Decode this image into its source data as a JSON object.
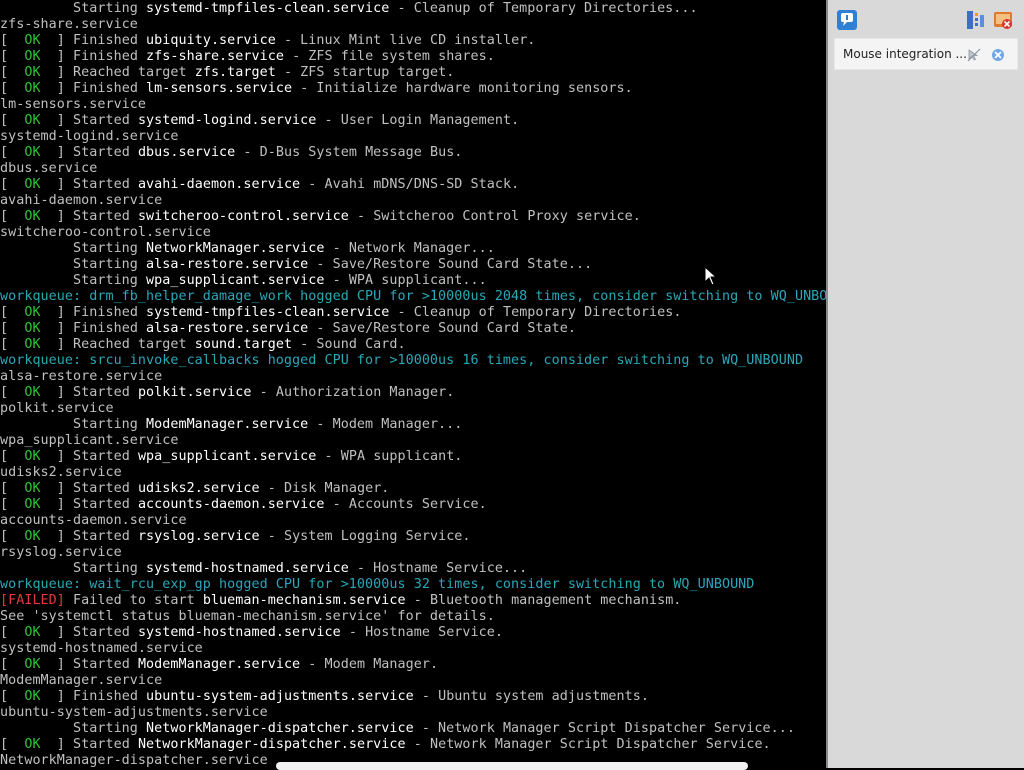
{
  "console": {
    "lines": [
      [
        [
          "plain",
          "         Starting "
        ],
        [
          "unit",
          "systemd-tmpfiles-clean.service"
        ],
        [
          "desc",
          " - Cleanup of Temporary Directories..."
        ]
      ],
      [
        [
          "plain",
          "zfs-share.service"
        ]
      ],
      [
        [
          "bracket",
          "[  "
        ],
        [
          "ok",
          "OK"
        ],
        [
          "bracket",
          "  ] "
        ],
        [
          "desc",
          "Finished "
        ],
        [
          "unit",
          "ubiquity.service"
        ],
        [
          "desc",
          " - Linux Mint live CD installer."
        ]
      ],
      [
        [
          "bracket",
          "[  "
        ],
        [
          "ok",
          "OK"
        ],
        [
          "bracket",
          "  ] "
        ],
        [
          "desc",
          "Finished "
        ],
        [
          "unit",
          "zfs-share.service"
        ],
        [
          "desc",
          " - ZFS file system shares."
        ]
      ],
      [
        [
          "bracket",
          "[  "
        ],
        [
          "ok",
          "OK"
        ],
        [
          "bracket",
          "  ] "
        ],
        [
          "desc",
          "Reached target "
        ],
        [
          "unit",
          "zfs.target"
        ],
        [
          "desc",
          " - ZFS startup target."
        ]
      ],
      [
        [
          "bracket",
          "[  "
        ],
        [
          "ok",
          "OK"
        ],
        [
          "bracket",
          "  ] "
        ],
        [
          "desc",
          "Finished "
        ],
        [
          "unit",
          "lm-sensors.service"
        ],
        [
          "desc",
          " - Initialize hardware monitoring sensors."
        ]
      ],
      [
        [
          "plain",
          "lm-sensors.service"
        ]
      ],
      [
        [
          "bracket",
          "[  "
        ],
        [
          "ok",
          "OK"
        ],
        [
          "bracket",
          "  ] "
        ],
        [
          "desc",
          "Started "
        ],
        [
          "unit",
          "systemd-logind.service"
        ],
        [
          "desc",
          " - User Login Management."
        ]
      ],
      [
        [
          "plain",
          "systemd-logind.service"
        ]
      ],
      [
        [
          "bracket",
          "[  "
        ],
        [
          "ok",
          "OK"
        ],
        [
          "bracket",
          "  ] "
        ],
        [
          "desc",
          "Started "
        ],
        [
          "unit",
          "dbus.service"
        ],
        [
          "desc",
          " - D-Bus System Message Bus."
        ]
      ],
      [
        [
          "plain",
          "dbus.service"
        ]
      ],
      [
        [
          "bracket",
          "[  "
        ],
        [
          "ok",
          "OK"
        ],
        [
          "bracket",
          "  ] "
        ],
        [
          "desc",
          "Started "
        ],
        [
          "unit",
          "avahi-daemon.service"
        ],
        [
          "desc",
          " - Avahi mDNS/DNS-SD Stack."
        ]
      ],
      [
        [
          "plain",
          "avahi-daemon.service"
        ]
      ],
      [
        [
          "bracket",
          "[  "
        ],
        [
          "ok",
          "OK"
        ],
        [
          "bracket",
          "  ] "
        ],
        [
          "desc",
          "Started "
        ],
        [
          "unit",
          "switcheroo-control.service"
        ],
        [
          "desc",
          " - Switcheroo Control Proxy service."
        ]
      ],
      [
        [
          "plain",
          "switcheroo-control.service"
        ]
      ],
      [
        [
          "plain",
          "         Starting "
        ],
        [
          "unit",
          "NetworkManager.service"
        ],
        [
          "desc",
          " - Network Manager..."
        ]
      ],
      [
        [
          "plain",
          "         Starting "
        ],
        [
          "unit",
          "alsa-restore.service"
        ],
        [
          "desc",
          " - Save/Restore Sound Card State..."
        ]
      ],
      [
        [
          "plain",
          "         Starting "
        ],
        [
          "unit",
          "wpa_supplicant.service"
        ],
        [
          "desc",
          " - WPA supplicant..."
        ]
      ],
      [
        [
          "wq",
          "workqueue: drm_fb_helper_damage_work hogged CPU for >10000us 2048 times, consider switching to WQ_UNBOUND"
        ]
      ],
      [
        [
          "bracket",
          "[  "
        ],
        [
          "ok",
          "OK"
        ],
        [
          "bracket",
          "  ] "
        ],
        [
          "desc",
          "Finished "
        ],
        [
          "unit",
          "systemd-tmpfiles-clean.service"
        ],
        [
          "desc",
          " - Cleanup of Temporary Directories."
        ]
      ],
      [
        [
          "bracket",
          "[  "
        ],
        [
          "ok",
          "OK"
        ],
        [
          "bracket",
          "  ] "
        ],
        [
          "desc",
          "Finished "
        ],
        [
          "unit",
          "alsa-restore.service"
        ],
        [
          "desc",
          " - Save/Restore Sound Card State."
        ]
      ],
      [
        [
          "bracket",
          "[  "
        ],
        [
          "ok",
          "OK"
        ],
        [
          "bracket",
          "  ] "
        ],
        [
          "desc",
          "Reached target "
        ],
        [
          "unit",
          "sound.target"
        ],
        [
          "desc",
          " - Sound Card."
        ]
      ],
      [
        [
          "wq",
          "workqueue: srcu_invoke_callbacks hogged CPU for >10000us 16 times, consider switching to WQ_UNBOUND"
        ]
      ],
      [
        [
          "plain",
          "alsa-restore.service"
        ]
      ],
      [
        [
          "bracket",
          "[  "
        ],
        [
          "ok",
          "OK"
        ],
        [
          "bracket",
          "  ] "
        ],
        [
          "desc",
          "Started "
        ],
        [
          "unit",
          "polkit.service"
        ],
        [
          "desc",
          " - Authorization Manager."
        ]
      ],
      [
        [
          "plain",
          "polkit.service"
        ]
      ],
      [
        [
          "plain",
          "         Starting "
        ],
        [
          "unit",
          "ModemManager.service"
        ],
        [
          "desc",
          " - Modem Manager..."
        ]
      ],
      [
        [
          "plain",
          "wpa_supplicant.service"
        ]
      ],
      [
        [
          "bracket",
          "[  "
        ],
        [
          "ok",
          "OK"
        ],
        [
          "bracket",
          "  ] "
        ],
        [
          "desc",
          "Started "
        ],
        [
          "unit",
          "wpa_supplicant.service"
        ],
        [
          "desc",
          " - WPA supplicant."
        ]
      ],
      [
        [
          "plain",
          "udisks2.service"
        ]
      ],
      [
        [
          "bracket",
          "[  "
        ],
        [
          "ok",
          "OK"
        ],
        [
          "bracket",
          "  ] "
        ],
        [
          "desc",
          "Started "
        ],
        [
          "unit",
          "udisks2.service"
        ],
        [
          "desc",
          " - Disk Manager."
        ]
      ],
      [
        [
          "bracket",
          "[  "
        ],
        [
          "ok",
          "OK"
        ],
        [
          "bracket",
          "  ] "
        ],
        [
          "desc",
          "Started "
        ],
        [
          "unit",
          "accounts-daemon.service"
        ],
        [
          "desc",
          " - Accounts Service."
        ]
      ],
      [
        [
          "plain",
          "accounts-daemon.service"
        ]
      ],
      [
        [
          "bracket",
          "[  "
        ],
        [
          "ok",
          "OK"
        ],
        [
          "bracket",
          "  ] "
        ],
        [
          "desc",
          "Started "
        ],
        [
          "unit",
          "rsyslog.service"
        ],
        [
          "desc",
          " - System Logging Service."
        ]
      ],
      [
        [
          "plain",
          "rsyslog.service"
        ]
      ],
      [
        [
          "plain",
          "         Starting "
        ],
        [
          "unit",
          "systemd-hostnamed.service"
        ],
        [
          "desc",
          " - Hostname Service..."
        ]
      ],
      [
        [
          "wq",
          "workqueue: wait_rcu_exp_gp hogged CPU for >10000us 32 times, consider switching to WQ_UNBOUND"
        ]
      ],
      [
        [
          "failed",
          "[FAILED]"
        ],
        [
          "desc",
          " Failed to start "
        ],
        [
          "unit",
          "blueman-mechanism.service"
        ],
        [
          "desc",
          " - Bluetooth management mechanism."
        ]
      ],
      [
        [
          "plain",
          "See 'systemctl status blueman-mechanism.service' for details."
        ]
      ],
      [
        [
          "bracket",
          "[  "
        ],
        [
          "ok",
          "OK"
        ],
        [
          "bracket",
          "  ] "
        ],
        [
          "desc",
          "Started "
        ],
        [
          "unit",
          "systemd-hostnamed.service"
        ],
        [
          "desc",
          " - Hostname Service."
        ]
      ],
      [
        [
          "plain",
          "systemd-hostnamed.service"
        ]
      ],
      [
        [
          "bracket",
          "[  "
        ],
        [
          "ok",
          "OK"
        ],
        [
          "bracket",
          "  ] "
        ],
        [
          "desc",
          "Started "
        ],
        [
          "unit",
          "ModemManager.service"
        ],
        [
          "desc",
          " - Modem Manager."
        ]
      ],
      [
        [
          "plain",
          "ModemManager.service"
        ]
      ],
      [
        [
          "bracket",
          "[  "
        ],
        [
          "ok",
          "OK"
        ],
        [
          "bracket",
          "  ] "
        ],
        [
          "desc",
          "Finished "
        ],
        [
          "unit",
          "ubuntu-system-adjustments.service"
        ],
        [
          "desc",
          " - Ubuntu system adjustments."
        ]
      ],
      [
        [
          "plain",
          "ubuntu-system-adjustments.service"
        ]
      ],
      [
        [
          "plain",
          "         Starting "
        ],
        [
          "unit",
          "NetworkManager-dispatcher.service"
        ],
        [
          "desc",
          " - Network Manager Script Dispatcher Service..."
        ]
      ],
      [
        [
          "bracket",
          "[  "
        ],
        [
          "ok",
          "OK"
        ],
        [
          "bracket",
          "  ] "
        ],
        [
          "desc",
          "Started "
        ],
        [
          "unit",
          "NetworkManager-dispatcher.service"
        ],
        [
          "desc",
          " - Network Manager Script Dispatcher Service."
        ]
      ],
      [
        [
          "plain",
          "NetworkManager-dispatcher.service"
        ]
      ]
    ]
  },
  "side_panel": {
    "notification": {
      "label": "Mouse integration ...",
      "icon_left": "message-bubble-icon",
      "icon_right_1": "network-adapter-icon",
      "icon_right_2": "close-notifications-icon"
    },
    "item_icons": {
      "mute": "mouse-integration-off-icon",
      "dismiss": "dismiss-icon"
    }
  },
  "colors": {
    "ok": "#2fc42f",
    "failed": "#e03a3a",
    "workqueue": "#2aa7b8",
    "unit": "#ffffff",
    "text": "#c0c0c0",
    "panel_bg": "#d9d9d9"
  }
}
